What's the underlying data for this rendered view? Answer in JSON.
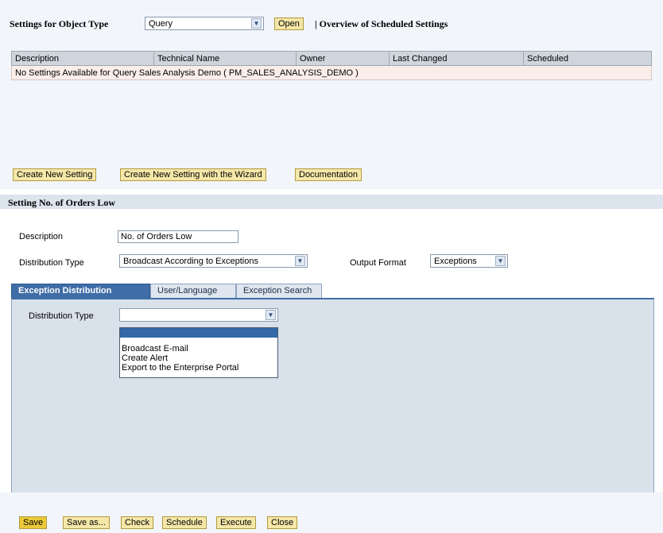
{
  "top": {
    "label": "Settings for Object Type",
    "object_type": "Query",
    "open_button": "Open",
    "overview": "| Overview of Scheduled Settings"
  },
  "table": {
    "headers": [
      "Description",
      "Technical Name",
      "Owner",
      "Last Changed",
      "Scheduled"
    ],
    "empty_message": "No Settings Available for Query Sales Analysis Demo ( PM_SALES_ANALYSIS_DEMO )"
  },
  "actions": {
    "create_new": "Create New Setting",
    "create_wizard": "Create New Setting with the Wizard",
    "documentation": "Documentation"
  },
  "setting": {
    "title": "Setting No. of Orders Low",
    "description_label": "Description",
    "description_value": "No. of Orders Low",
    "dist_type_label": "Distribution Type",
    "dist_type_value": "Broadcast According to Exceptions",
    "output_format_label": "Output Format",
    "output_format_value": "Exceptions"
  },
  "tabs": [
    {
      "label": "Exception Distribution",
      "active": true
    },
    {
      "label": "User/Language",
      "active": false
    },
    {
      "label": "Exception Search",
      "active": false
    }
  ],
  "panel": {
    "dist_type_label": "Distribution Type",
    "dist_type_value": "",
    "options": [
      "",
      "Broadcast E-mail",
      "Create Alert",
      "Export to the Enterprise Portal"
    ]
  },
  "footer": {
    "save": "Save",
    "save_as": "Save as...",
    "check": "Check",
    "schedule": "Schedule",
    "execute": "Execute",
    "close": "Close"
  },
  "icons": {
    "dropdown_arrow": "chevron-down-icon"
  }
}
